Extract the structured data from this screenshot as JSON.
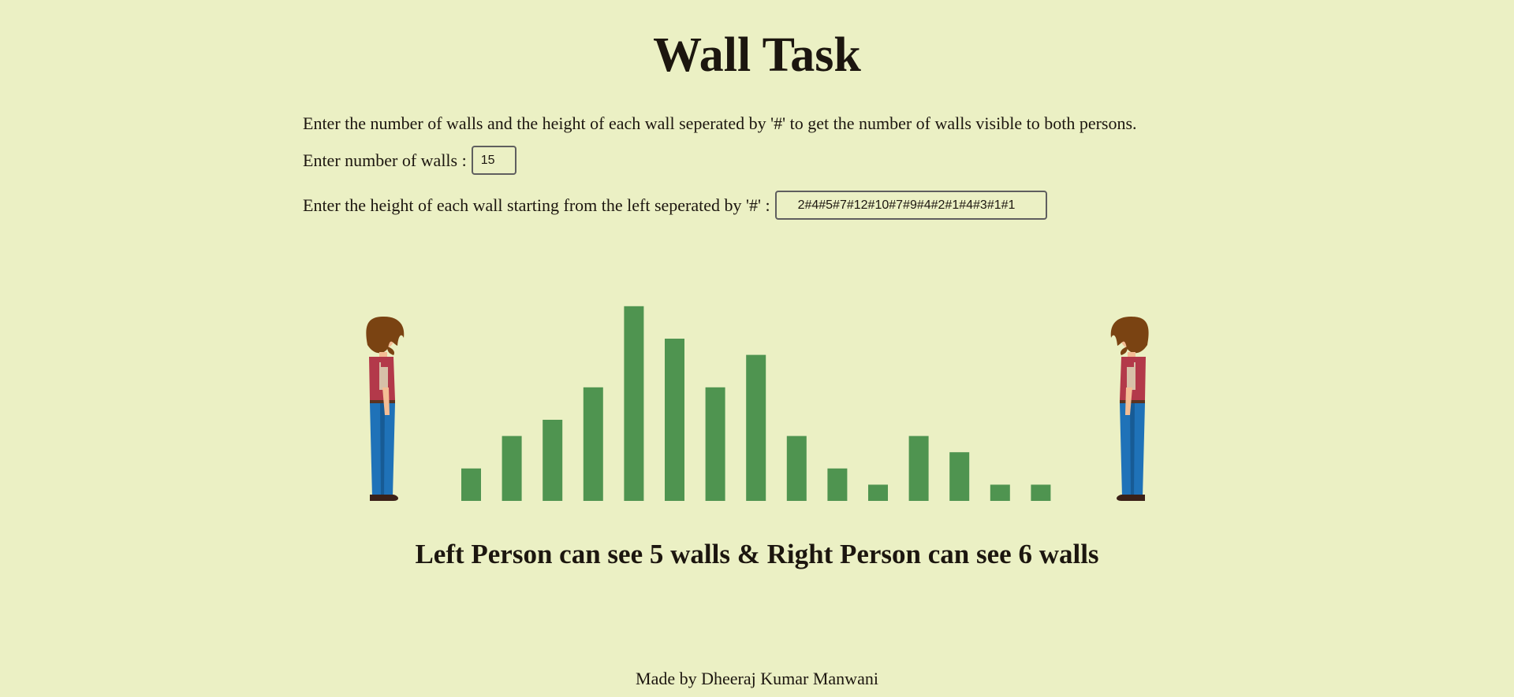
{
  "page": {
    "title": "Wall Task",
    "instructions": "Enter the number of walls and the height of each wall seperated by '#' to get the number of walls visible to both persons."
  },
  "form": {
    "count_label": "Enter number of walls :",
    "count_value": "15",
    "heights_label": "Enter the height of each wall starting from the left seperated by '#' :",
    "heights_value": "2#4#5#7#12#10#7#9#4#2#1#4#3#1#1"
  },
  "scene": {
    "wall_heights": [
      2,
      4,
      5,
      7,
      12,
      10,
      7,
      9,
      4,
      2,
      1,
      4,
      3,
      1,
      1
    ],
    "wall_color": "#4f9450",
    "left_person_icon": "person-facing-right-icon",
    "right_person_icon": "person-facing-left-icon"
  },
  "result": {
    "text": "Left Person can see 5 walls & Right Person can see 6 walls"
  },
  "footer": {
    "text": "Made by Dheeraj Kumar Manwani"
  }
}
